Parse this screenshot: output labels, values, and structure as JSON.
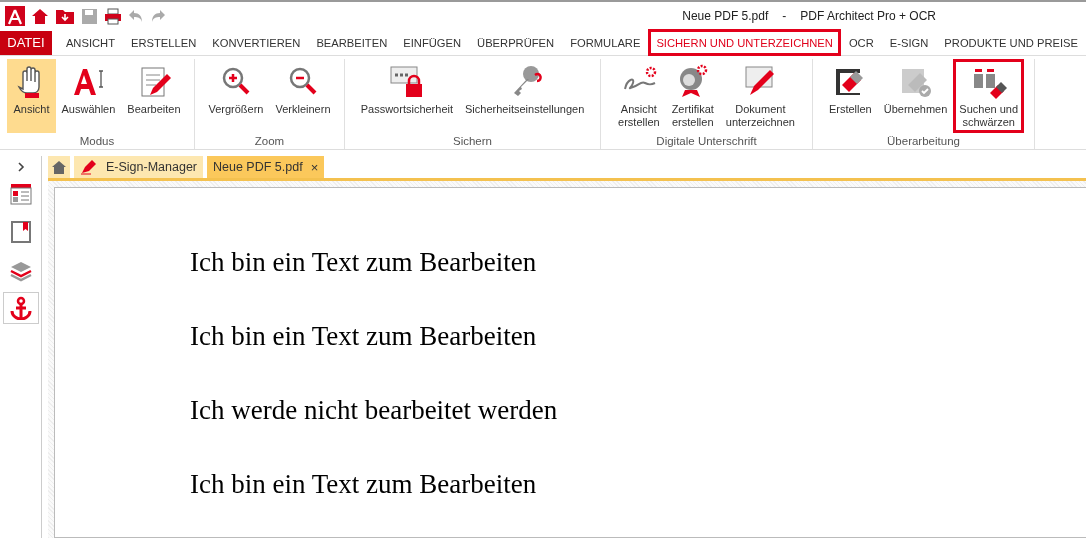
{
  "window": {
    "document": "Neue PDF 5.pdf",
    "separator": "-",
    "app": "PDF Architect Pro + OCR"
  },
  "quick_access": [
    {
      "disabled": false
    },
    {
      "disabled": false
    },
    {
      "disabled": false
    },
    {
      "disabled": true
    },
    {
      "disabled": false
    },
    {
      "disabled": true
    },
    {
      "disabled": true
    }
  ],
  "file_tab": "DATEI",
  "menu_tabs": [
    {
      "label": "ANSICHT",
      "selected": false
    },
    {
      "label": "ERSTELLEN",
      "selected": false
    },
    {
      "label": "KONVERTIEREN",
      "selected": false
    },
    {
      "label": "BEARBEITEN",
      "selected": false
    },
    {
      "label": "EINFÜGEN",
      "selected": false
    },
    {
      "label": "ÜBERPRÜFEN",
      "selected": false
    },
    {
      "label": "FORMULARE",
      "selected": false
    },
    {
      "label": "SICHERN UND UNTERZEICHNEN",
      "selected": true
    },
    {
      "label": "OCR",
      "selected": false
    },
    {
      "label": "E-SIGN",
      "selected": false
    },
    {
      "label": "PRODUKTE UND PREISE",
      "selected": false
    }
  ],
  "ribbon_groups": [
    {
      "label": "Modus",
      "buttons": [
        {
          "label": "Ansicht",
          "active": true,
          "highlighted": false
        },
        {
          "label": "Auswählen",
          "active": false,
          "highlighted": false
        },
        {
          "label": "Bearbeiten",
          "active": false,
          "highlighted": false
        }
      ]
    },
    {
      "label": "Zoom",
      "buttons": [
        {
          "label": "Vergrößern",
          "active": false,
          "highlighted": false
        },
        {
          "label": "Verkleinern",
          "active": false,
          "highlighted": false
        }
      ]
    },
    {
      "label": "Sichern",
      "buttons": [
        {
          "label": "Passwortsicherheit",
          "active": false,
          "highlighted": false
        },
        {
          "label": "Sicherheitseinstellungen",
          "active": false,
          "highlighted": false
        }
      ]
    },
    {
      "label": "Digitale Unterschrift",
      "buttons": [
        {
          "label": "Ansicht\nerstellen",
          "active": false,
          "highlighted": false
        },
        {
          "label": "Zertifikat\nerstellen",
          "active": false,
          "highlighted": false
        },
        {
          "label": "Dokument\nunterzeichnen",
          "active": false,
          "highlighted": false
        }
      ]
    },
    {
      "label": "Überarbeitung",
      "buttons": [
        {
          "label": "Erstellen",
          "active": false,
          "highlighted": false
        },
        {
          "label": "Übernehmen",
          "active": false,
          "highlighted": false
        },
        {
          "label": "Suchen und\nschwärzen",
          "active": false,
          "highlighted": true
        }
      ]
    }
  ],
  "side_panel": [
    {
      "selected": false
    },
    {
      "selected": false
    },
    {
      "selected": false
    },
    {
      "selected": true
    }
  ],
  "doc_tabs": [
    {
      "label": "E-Sign-Manager",
      "selected": false,
      "closable": false
    },
    {
      "label": "Neue PDF 5.pdf",
      "selected": true,
      "closable": true
    }
  ],
  "close_glyph": "×",
  "document_lines": [
    "Ich bin ein Text zum Bearbeiten",
    "Ich bin ein Text zum Bearbeiten",
    "Ich werde nicht bearbeitet werden",
    "Ich bin ein Text zum Bearbeiten"
  ]
}
